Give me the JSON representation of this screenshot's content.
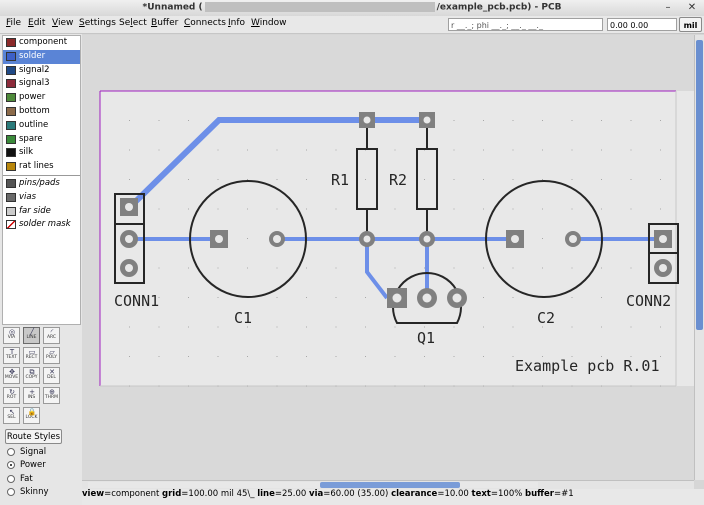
{
  "window": {
    "title_prefix": "*Unnamed (",
    "title_suffix": "/example_pcb.pcb) - PCB",
    "minimize_glyph": "–",
    "close_glyph": "✕"
  },
  "menu": [
    {
      "label": "File",
      "key": "F"
    },
    {
      "label": "Edit",
      "key": "E"
    },
    {
      "label": "View",
      "key": "V"
    },
    {
      "label": "Settings",
      "key": "S"
    },
    {
      "label": "Select",
      "key": "l"
    },
    {
      "label": "Buffer",
      "key": "B"
    },
    {
      "label": "Connects",
      "key": "C"
    },
    {
      "label": "Info",
      "key": "I"
    },
    {
      "label": "Window",
      "key": "W"
    }
  ],
  "coords": {
    "relative": "r __._; phi __._; __._ __._",
    "position": "0.00 0.00",
    "units_button": "mil"
  },
  "layers": [
    {
      "label": "component",
      "color": "#8b2a2a",
      "selected": false
    },
    {
      "label": "solder",
      "color": "#3d60c8",
      "selected": true
    },
    {
      "label": "signal2",
      "color": "#204a86",
      "selected": false
    },
    {
      "label": "signal3",
      "color": "#8b2a3a",
      "selected": false
    },
    {
      "label": "power",
      "color": "#4e8a3a",
      "selected": false
    },
    {
      "label": "bottom",
      "color": "#8b6a4a",
      "selected": false
    },
    {
      "label": "outline",
      "color": "#2a7a7a",
      "selected": false
    },
    {
      "label": "spare",
      "color": "#3a8a3a",
      "selected": false
    },
    {
      "label": "silk",
      "color": "#111111",
      "selected": false
    },
    {
      "label": "rat lines",
      "color": "#b8860b",
      "selected": false
    }
  ],
  "special_layers": [
    {
      "label": "pins/pads",
      "color": "#555555"
    },
    {
      "label": "vias",
      "color": "#6a6a6a"
    },
    {
      "label": "far side",
      "color": "#cccccc"
    },
    {
      "label": "solder mask",
      "color": "#ffffff"
    }
  ],
  "tools": [
    [
      "VIA",
      "LINE",
      "ARC"
    ],
    [
      "TEXT",
      "RECT",
      "POLY"
    ],
    [
      "MOVE",
      "COPY",
      "DEL"
    ],
    [
      "ROT",
      "INS",
      "THRM"
    ],
    [
      "SEL",
      "LOCK"
    ]
  ],
  "tool_icons": [
    [
      "◎",
      "╱",
      "◜"
    ],
    [
      "T",
      "▭",
      "▱"
    ],
    [
      "✥",
      "⧉",
      "✕"
    ],
    [
      "↻",
      "+",
      "⊕"
    ],
    [
      "↖",
      "🔒"
    ]
  ],
  "route_styles": {
    "button": "Route Styles",
    "options": [
      "Signal",
      "Power",
      "Fat",
      "Skinny"
    ],
    "selected": "Power"
  },
  "board": {
    "labels": {
      "conn1": "CONN1",
      "conn2": "CONN2",
      "c1": "C1",
      "c2": "C2",
      "r1": "R1",
      "r2": "R2",
      "q1": "Q1",
      "caption": "Example pcb R.01"
    },
    "colors": {
      "board_bg": "#e8e8e8",
      "outline": "#a020c0",
      "trace": "#6d8fe8",
      "silk": "#262626",
      "pad": "#808080",
      "grid": "#a8a8a8"
    }
  },
  "status": {
    "view": "component",
    "grid": "100.00 mil",
    "angle": "45\\_",
    "line": "25.00",
    "via": "60.00 (35.00)",
    "clearance": "10.00",
    "text": "100%",
    "buffer": "#1"
  }
}
